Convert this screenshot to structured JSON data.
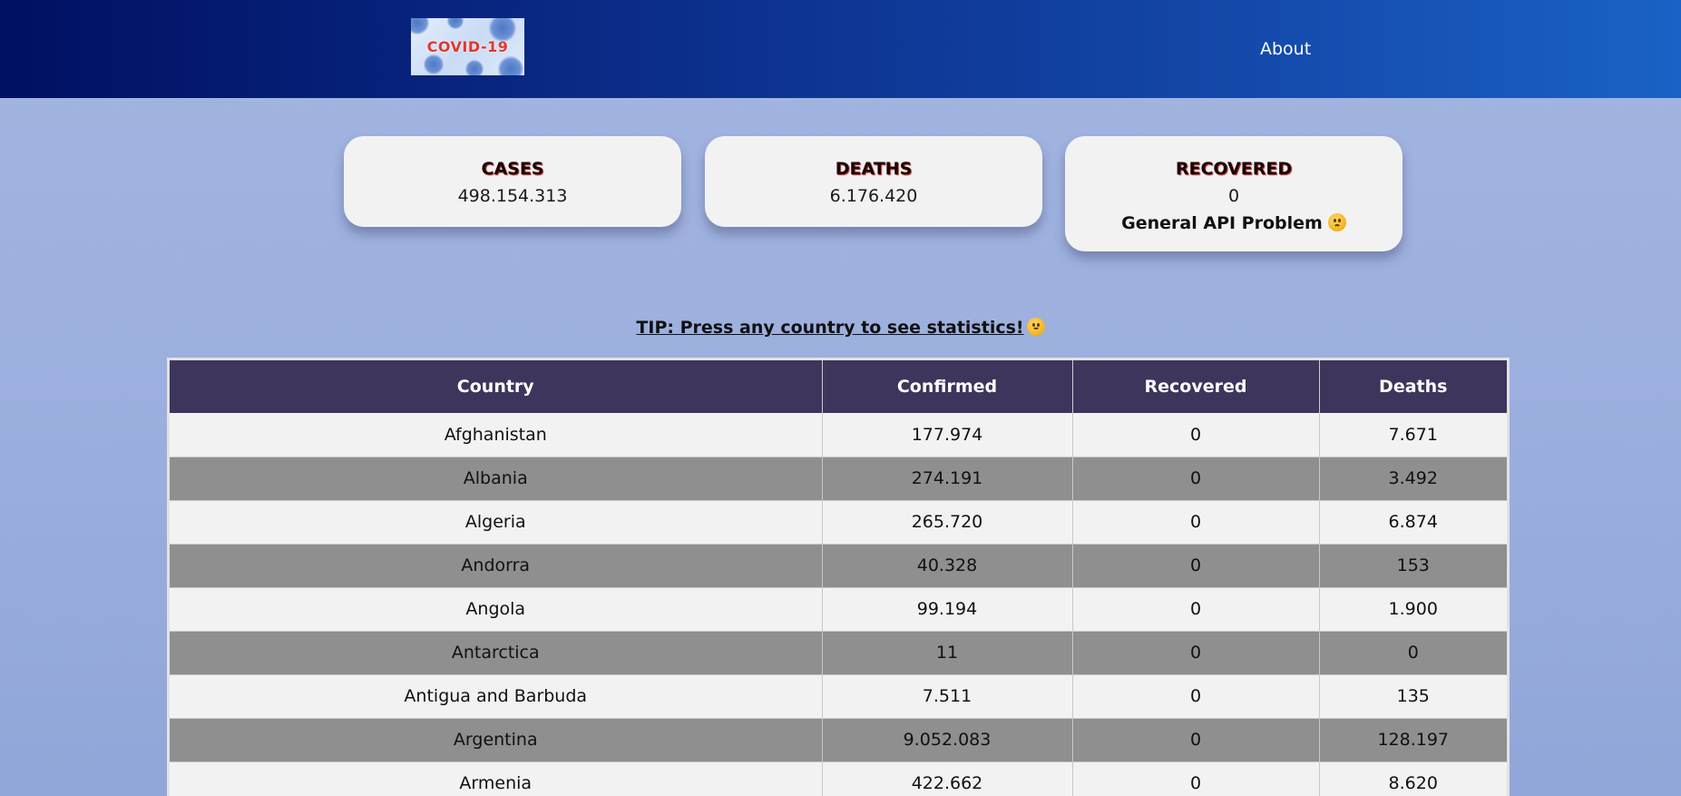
{
  "header": {
    "logo_text": "COVID-19",
    "nav": {
      "about": "About"
    }
  },
  "stats": {
    "cases": {
      "title": "CASES",
      "value": "498.154.313"
    },
    "deaths": {
      "title": "DEATHS",
      "value": "6.176.420"
    },
    "recovered": {
      "title": "RECOVERED",
      "value": "0",
      "note": "General API Problem"
    }
  },
  "tip": "TIP: Press any country to see statistics!",
  "table": {
    "columns": [
      "Country",
      "Confirmed",
      "Recovered",
      "Deaths"
    ],
    "rows": [
      [
        "Afghanistan",
        "177.974",
        "0",
        "7.671"
      ],
      [
        "Albania",
        "274.191",
        "0",
        "3.492"
      ],
      [
        "Algeria",
        "265.720",
        "0",
        "6.874"
      ],
      [
        "Andorra",
        "40.328",
        "0",
        "153"
      ],
      [
        "Angola",
        "99.194",
        "0",
        "1.900"
      ],
      [
        "Antarctica",
        "11",
        "0",
        "0"
      ],
      [
        "Antigua and Barbuda",
        "7.511",
        "0",
        "135"
      ],
      [
        "Argentina",
        "9.052.083",
        "0",
        "128.197"
      ],
      [
        "Armenia",
        "422.662",
        "0",
        "8.620"
      ]
    ]
  },
  "icons": {
    "sad_face": "frowning-face-emoji",
    "smile_face": "slightly-smiling-face-emoji"
  }
}
